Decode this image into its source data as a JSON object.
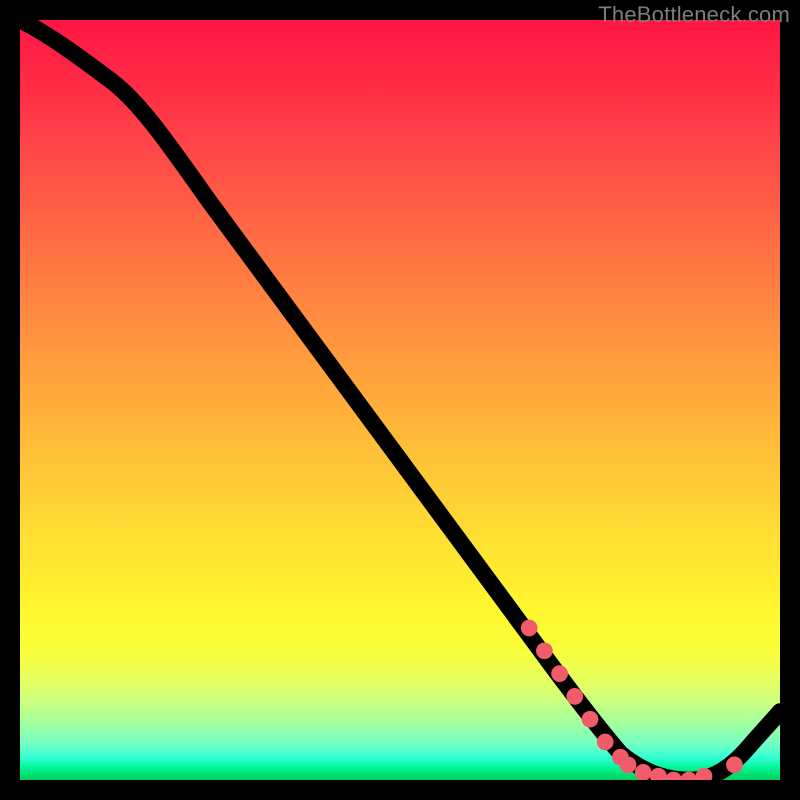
{
  "watermark": "TheBottleneck.com",
  "chart_data": {
    "type": "line",
    "title": "",
    "xlabel": "",
    "ylabel": "",
    "xlim": [
      0,
      100
    ],
    "ylim": [
      0,
      100
    ],
    "grid": false,
    "legend": false,
    "series": [
      {
        "name": "bottleneck-curve",
        "x": [
          0,
          4,
          8,
          12,
          20,
          30,
          40,
          50,
          60,
          66,
          70,
          74,
          78,
          82,
          86,
          90,
          94,
          98,
          100
        ],
        "y": [
          100,
          98,
          95,
          92,
          83,
          70,
          57,
          44,
          31,
          22,
          15,
          9,
          4,
          1,
          0,
          0,
          1,
          4,
          8
        ]
      }
    ],
    "highlight_points": {
      "name": "optimal-range-markers",
      "x": [
        67,
        69,
        71,
        73,
        75,
        77,
        79,
        80,
        82,
        84,
        86,
        88,
        90,
        94
      ],
      "y": [
        20,
        17,
        14,
        11,
        8,
        5,
        3,
        2,
        1,
        0.5,
        0,
        0,
        0.5,
        2
      ]
    }
  }
}
